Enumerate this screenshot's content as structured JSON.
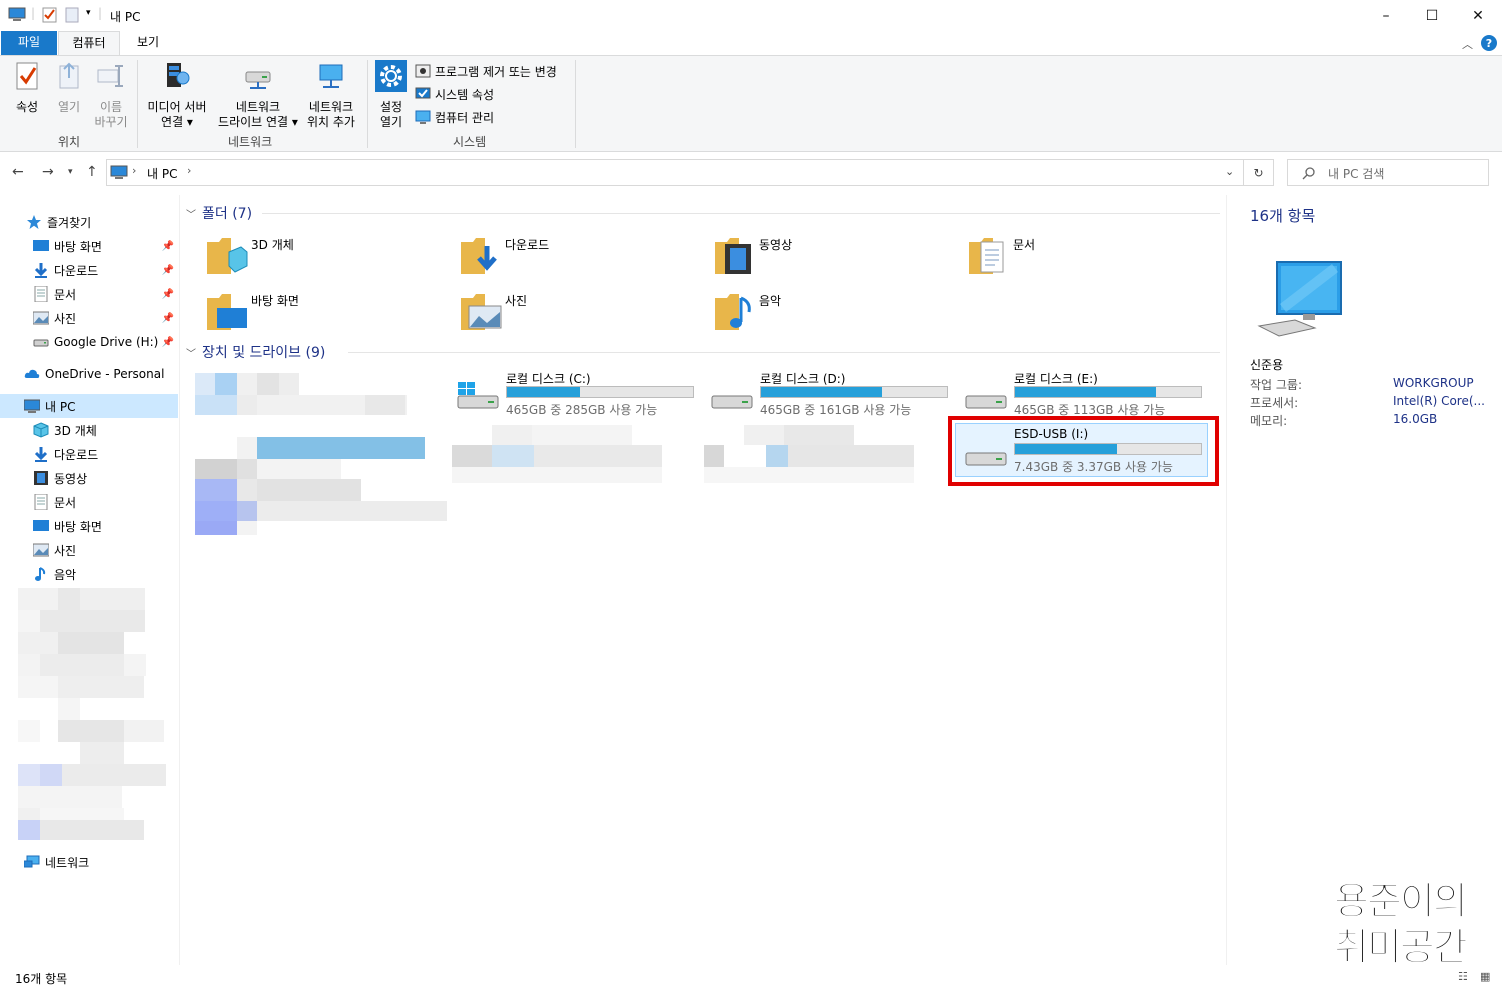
{
  "window": {
    "title": "내 PC",
    "controls": {
      "minimize": "–",
      "maximize": "☐",
      "close": "✕"
    }
  },
  "ribbon": {
    "tabs": [
      {
        "label": "파일",
        "active_style": "file"
      },
      {
        "label": "컴퓨터",
        "selected": true
      },
      {
        "label": "보기"
      }
    ],
    "groups": {
      "location": {
        "label": "위치",
        "buttons": [
          {
            "label": "속성",
            "icon": "checkmark-properties-icon",
            "enabled": true
          },
          {
            "label": "열기",
            "icon": "open-icon",
            "enabled": false
          },
          {
            "label_1": "이름",
            "label_2": "바꾸기",
            "icon": "rename-icon",
            "enabled": false
          }
        ]
      },
      "network": {
        "label": "네트워크",
        "buttons": [
          {
            "label_1": "미디어 서버",
            "label_2": "연결 ▾",
            "icon": "media-server-icon"
          },
          {
            "label_1": "네트워크",
            "label_2": "드라이브 연결 ▾",
            "icon": "network-drive-icon"
          },
          {
            "label_1": "네트워크",
            "label_2": "위치 추가",
            "icon": "network-location-icon"
          }
        ]
      },
      "system": {
        "label": "시스템",
        "settings": {
          "label_1": "설정",
          "label_2": "열기",
          "icon": "gear-icon"
        },
        "items": [
          {
            "label": "프로그램 제거 또는 변경",
            "icon": "uninstall-icon"
          },
          {
            "label": "시스템 속성",
            "icon": "system-properties-icon"
          },
          {
            "label": "컴퓨터 관리",
            "icon": "computer-management-icon"
          }
        ]
      }
    }
  },
  "navigation": {
    "breadcrumb": [
      "내 PC"
    ],
    "search_placeholder": "내 PC 검색"
  },
  "sidebar": {
    "quick_access": {
      "label": "즐겨찾기",
      "icon": "star-icon"
    },
    "quick_items": [
      {
        "label": "바탕 화면",
        "icon": "desktop-icon",
        "pinned": true
      },
      {
        "label": "다운로드",
        "icon": "download-icon",
        "pinned": true
      },
      {
        "label": "문서",
        "icon": "documents-icon",
        "pinned": true
      },
      {
        "label": "사진",
        "icon": "pictures-icon",
        "pinned": true
      },
      {
        "label": "Google Drive (H:)",
        "icon": "drive-icon",
        "pinned": true
      }
    ],
    "onedrive": {
      "label": "OneDrive - Personal",
      "icon": "cloud-icon"
    },
    "this_pc": {
      "label": "내 PC",
      "icon": "computer-icon",
      "selected": true
    },
    "pc_items": [
      {
        "label": "3D 개체",
        "icon": "3d-objects-icon"
      },
      {
        "label": "다운로드",
        "icon": "download-icon"
      },
      {
        "label": "동영상",
        "icon": "videos-icon"
      },
      {
        "label": "문서",
        "icon": "documents-icon"
      },
      {
        "label": "바탕 화면",
        "icon": "desktop-icon"
      },
      {
        "label": "사진",
        "icon": "pictures-icon"
      },
      {
        "label": "음악",
        "icon": "music-icon"
      }
    ],
    "network": {
      "label": "네트워크",
      "icon": "network-icon"
    }
  },
  "content": {
    "folders_section": "폴더 (7)",
    "folders": [
      {
        "label": "3D 개체",
        "icon": "3d-objects-folder-icon"
      },
      {
        "label": "다운로드",
        "icon": "downloads-folder-icon"
      },
      {
        "label": "동영상",
        "icon": "videos-folder-icon"
      },
      {
        "label": "문서",
        "icon": "documents-folder-icon"
      },
      {
        "label": "바탕 화면",
        "icon": "desktop-folder-icon"
      },
      {
        "label": "사진",
        "icon": "pictures-folder-icon"
      },
      {
        "label": "음악",
        "icon": "music-folder-icon"
      }
    ],
    "drives_section": "장치 및 드라이브 (9)",
    "drives": [
      {
        "name": "로컬 디스크 (C:)",
        "free": "465GB 중 285GB 사용 가능",
        "used_fraction": 0.39,
        "icon": "windows-drive-icon"
      },
      {
        "name": "로컬 디스크 (D:)",
        "free": "465GB 중 161GB 사용 가능",
        "used_fraction": 0.65,
        "icon": "hard-drive-icon"
      },
      {
        "name": "로컬 디스크 (E:)",
        "free": "465GB 중 113GB 사용 가능",
        "used_fraction": 0.76,
        "icon": "hard-drive-icon"
      },
      {
        "name": "ESD-USB (I:)",
        "free": "7.43GB 중 3.37GB 사용 가능",
        "used_fraction": 0.55,
        "icon": "usb-drive-icon",
        "highlighted": true
      }
    ],
    "highlight_color": "#e00000",
    "bar_color": "#26a0da"
  },
  "details": {
    "count": "16개 항목",
    "computer_name": "신준용",
    "rows": [
      {
        "label": "작업 그룹:",
        "value": "WORKGROUP"
      },
      {
        "label": "프로세서:",
        "value": "Intel(R) Core(..."
      },
      {
        "label": "메모리:",
        "value": "16.0GB"
      }
    ]
  },
  "status": {
    "count": "16개 항목"
  },
  "watermark": {
    "line_1": "용준이의",
    "line_2": "취미공간"
  }
}
